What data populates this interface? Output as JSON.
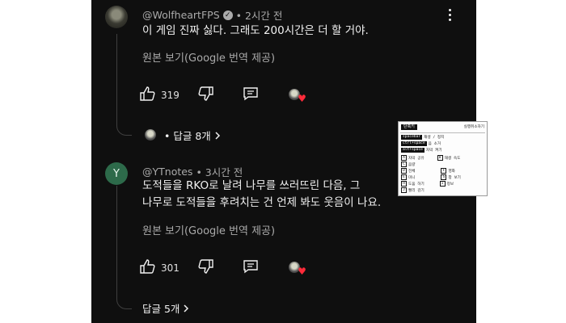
{
  "comments": [
    {
      "author": "@WolfheartFPS",
      "verified": true,
      "time": "• 2시간 전",
      "text_lines": [
        "이 게임 진짜 싫다. 그래도 200시간은 더 할 거야."
      ],
      "translate": "원본 보기(Google 번역 제공)",
      "likes": "319",
      "replies": "• 답글 8개",
      "avatar_letter": ""
    },
    {
      "author": "@YTnotes",
      "verified": false,
      "time": "• 3시간 전",
      "text_lines": [
        "도적들을 RKO로 날려 나무를 쓰러뜨린 다음, 그",
        "나무로 도적들을 후려치는 건 언제 봐도 웃음이 나요."
      ],
      "translate": "원본 보기(Google 번역 제공)",
      "likes": "301",
      "replies": "답글 5개",
      "avatar_letter": "Y"
    }
  ],
  "popup": {
    "title": "단축키",
    "close": "실행취소하기",
    "rows": [
      {
        "key": "spacebar",
        "label": "재생 / 정지"
      },
      {
        "key": "ctrl+space",
        "label": "음 소거"
      },
      {
        "key": "alt+space",
        "label": "자막 켜기"
      },
      {
        "key": "A",
        "label": "자막 공유",
        "key2": "B",
        "label2": "재생 속도"
      },
      {
        "key": "C",
        "label": "음량"
      },
      {
        "key": "D",
        "label": "전체",
        "key2": "F",
        "label2": "영화"
      },
      {
        "key": "E",
        "label": "미니",
        "key2": "G",
        "label2": "창 보기"
      },
      {
        "key": "H",
        "label": "도움 하기",
        "key2": "I",
        "label2": "정보"
      },
      {
        "key": "J",
        "label": "빨리 감기"
      }
    ]
  },
  "colors": {
    "background": "#0f0f0f",
    "text": "#f1f1f1",
    "muted": "#aaaaaa",
    "heart": "#ff2b3a",
    "avatar_y": "#2d6a4a"
  }
}
